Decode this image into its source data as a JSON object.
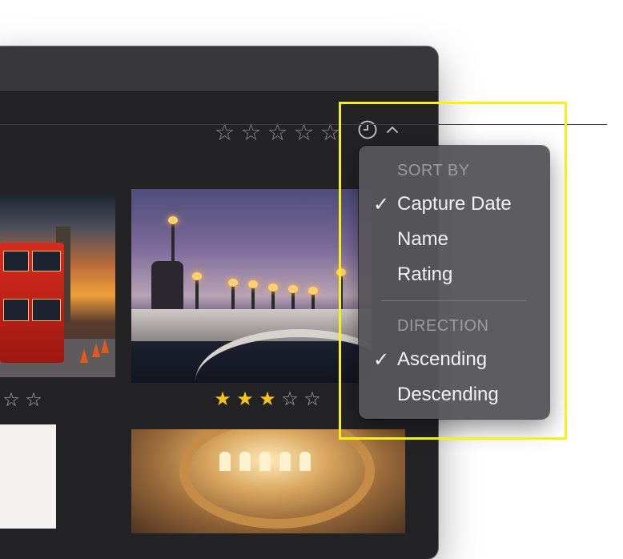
{
  "toolbar": {
    "rating_filter_stars": [
      "☆",
      "☆",
      "☆",
      "☆",
      "☆"
    ],
    "sort_icon": "clock-icon",
    "sort_chevron": "chevron-up-icon"
  },
  "photos": [
    {
      "subject": "london-bus",
      "rating_visible": [
        "☆",
        "☆"
      ]
    },
    {
      "subject": "paris-bridge",
      "rating": 3,
      "rating_stars": [
        "★",
        "★",
        "★",
        "☆",
        "☆"
      ]
    },
    {
      "subject": "white-photo"
    },
    {
      "subject": "basilica-interior"
    }
  ],
  "sort_menu": {
    "section_sort": "SORT BY",
    "sort_options": [
      {
        "label": "Capture Date",
        "checked": "✓"
      },
      {
        "label": "Name",
        "checked": ""
      },
      {
        "label": "Rating",
        "checked": ""
      }
    ],
    "section_direction": "DIRECTION",
    "direction_options": [
      {
        "label": "Ascending",
        "checked": "✓"
      },
      {
        "label": "Descending",
        "checked": ""
      }
    ]
  },
  "colors": {
    "highlight": "#f6f116",
    "star_filled": "#f7c51b",
    "window_bg": "#232225"
  }
}
